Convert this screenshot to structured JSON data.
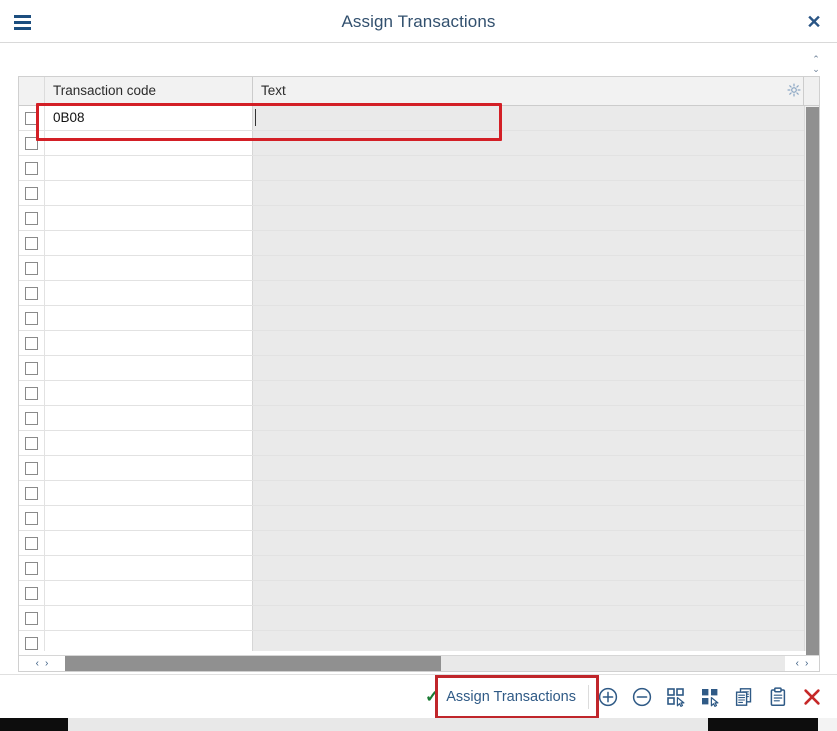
{
  "window": {
    "title": "Assign Transactions",
    "menu_icon": "hamburger-menu-icon",
    "close_icon": "close-icon",
    "close_glyph": "✕"
  },
  "grid": {
    "columns": [
      {
        "key": "select",
        "label": ""
      },
      {
        "key": "tcode",
        "label": "Transaction code"
      },
      {
        "key": "text",
        "label": "Text"
      }
    ],
    "settings_icon": "grid-settings-icon",
    "rows": [
      {
        "tcode": "0B08",
        "text": "",
        "selected": false,
        "focused": true
      },
      {
        "tcode": "",
        "text": "",
        "selected": false
      },
      {
        "tcode": "",
        "text": "",
        "selected": false
      },
      {
        "tcode": "",
        "text": "",
        "selected": false
      },
      {
        "tcode": "",
        "text": "",
        "selected": false
      },
      {
        "tcode": "",
        "text": "",
        "selected": false
      },
      {
        "tcode": "",
        "text": "",
        "selected": false
      },
      {
        "tcode": "",
        "text": "",
        "selected": false
      },
      {
        "tcode": "",
        "text": "",
        "selected": false
      },
      {
        "tcode": "",
        "text": "",
        "selected": false
      },
      {
        "tcode": "",
        "text": "",
        "selected": false
      },
      {
        "tcode": "",
        "text": "",
        "selected": false
      },
      {
        "tcode": "",
        "text": "",
        "selected": false
      },
      {
        "tcode": "",
        "text": "",
        "selected": false
      },
      {
        "tcode": "",
        "text": "",
        "selected": false
      },
      {
        "tcode": "",
        "text": "",
        "selected": false
      },
      {
        "tcode": "",
        "text": "",
        "selected": false
      },
      {
        "tcode": "",
        "text": "",
        "selected": false
      },
      {
        "tcode": "",
        "text": "",
        "selected": false
      },
      {
        "tcode": "",
        "text": "",
        "selected": false
      },
      {
        "tcode": "",
        "text": "",
        "selected": false
      },
      {
        "tcode": "",
        "text": "",
        "selected": false
      }
    ]
  },
  "scrollbars": {
    "vertical_up_glyph": "⌃",
    "vertical_down_glyph": "⌄",
    "horizontal_left_glyph": "‹",
    "horizontal_right_glyph": "›"
  },
  "footer": {
    "primary_action": {
      "label": "Assign Transactions",
      "icon": "checkmark-icon",
      "glyph": "✓"
    },
    "buttons": [
      {
        "name": "add-row-button",
        "icon": "plus-circle-icon"
      },
      {
        "name": "delete-row-button",
        "icon": "minus-circle-icon"
      },
      {
        "name": "select-all-button",
        "icon": "select-all-icon"
      },
      {
        "name": "deselect-all-button",
        "icon": "deselect-all-icon"
      },
      {
        "name": "copy-button",
        "icon": "copy-icon"
      },
      {
        "name": "paste-button",
        "icon": "paste-icon"
      },
      {
        "name": "close-button",
        "icon": "close-x-icon"
      }
    ]
  },
  "colors": {
    "accent": "#2f5a86",
    "highlight_red": "#d31f26",
    "check_green": "#1a7a33",
    "close_red": "#c62828",
    "readonly_cell": "#eaeaea",
    "header_bg": "#f2f2f2",
    "scroll_thumb": "#909090"
  }
}
